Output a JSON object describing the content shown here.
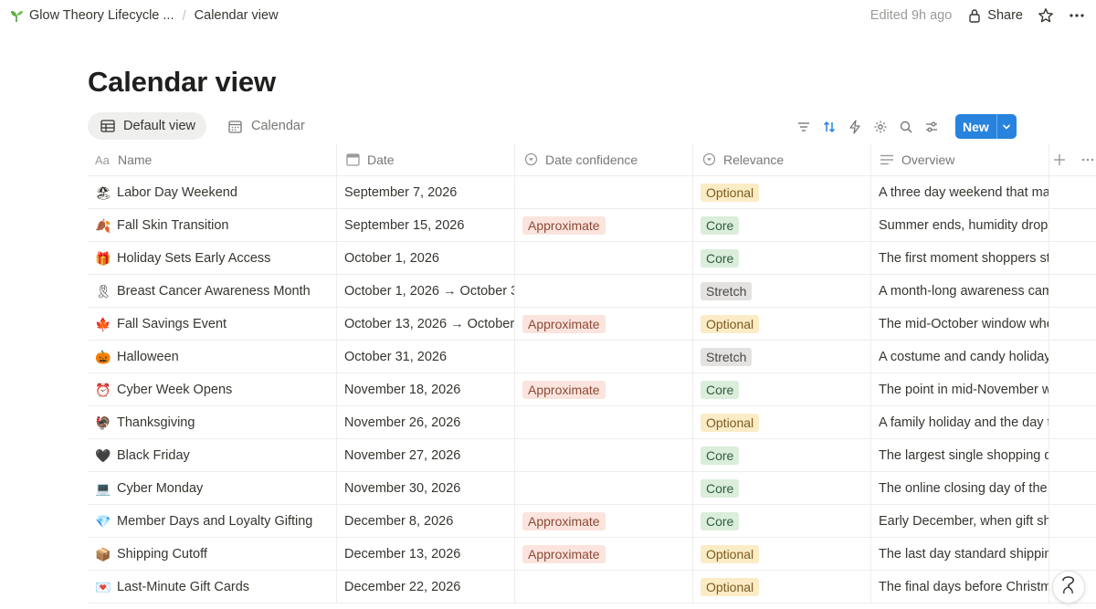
{
  "breadcrumb": {
    "parent": "Glow Theory Lifecycle ...",
    "current": "Calendar view",
    "parent_icon": "sprout-icon"
  },
  "topbar": {
    "edited": "Edited 9h ago",
    "share_label": "Share"
  },
  "page": {
    "title": "Calendar view"
  },
  "views": [
    {
      "label": "Default view",
      "icon": "table-icon",
      "active": true
    },
    {
      "label": "Calendar",
      "icon": "calendar-icon",
      "active": false
    }
  ],
  "toolbar": {
    "new_label": "New"
  },
  "columns": [
    {
      "label": "Name",
      "icon": "text-icon"
    },
    {
      "label": "Date",
      "icon": "calendar-icon"
    },
    {
      "label": "Date confidence",
      "icon": "select-icon"
    },
    {
      "label": "Relevance",
      "icon": "select-icon"
    },
    {
      "label": "Overview",
      "icon": "lines-icon"
    }
  ],
  "rows": [
    {
      "emoji": "🏖",
      "name": "Labor Day Weekend",
      "date": "September 7, 2026",
      "confidence": "",
      "relevance": "Optional",
      "overview": "A three day weekend that mar"
    },
    {
      "emoji": "🍂",
      "name": "Fall Skin Transition",
      "date": "September 15, 2026",
      "confidence": "Approximate",
      "relevance": "Core",
      "overview": "Summer ends, humidity drops"
    },
    {
      "emoji": "🎁",
      "name": "Holiday Sets Early Access",
      "date": "October 1, 2026",
      "confidence": "",
      "relevance": "Core",
      "overview": "The first moment shoppers sta"
    },
    {
      "emoji": "🎗",
      "name": "Breast Cancer Awareness Month",
      "date": "October 1, 2026 → October 3",
      "confidence": "",
      "relevance": "Stretch",
      "overview": "A month-long awareness cam"
    },
    {
      "emoji": "🍁",
      "name": "Fall Savings Event",
      "date": "October 13, 2026 → October",
      "confidence": "Approximate",
      "relevance": "Optional",
      "overview": "The mid-October window whe"
    },
    {
      "emoji": "🎃",
      "name": "Halloween",
      "date": "October 31, 2026",
      "confidence": "",
      "relevance": "Stretch",
      "overview": "A costume and candy holiday"
    },
    {
      "emoji": "⏰",
      "name": "Cyber Week Opens",
      "date": "November 18, 2026",
      "confidence": "Approximate",
      "relevance": "Core",
      "overview": "The point in mid-November w"
    },
    {
      "emoji": "🦃",
      "name": "Thanksgiving",
      "date": "November 26, 2026",
      "confidence": "",
      "relevance": "Optional",
      "overview": "A family holiday and the day t"
    },
    {
      "emoji": "🖤",
      "name": "Black Friday",
      "date": "November 27, 2026",
      "confidence": "",
      "relevance": "Core",
      "overview": "The largest single shopping d"
    },
    {
      "emoji": "💻",
      "name": "Cyber Monday",
      "date": "November 30, 2026",
      "confidence": "",
      "relevance": "Core",
      "overview": "The online closing day of the"
    },
    {
      "emoji": "💎",
      "name": "Member Days and Loyalty Gifting",
      "date": "December 8, 2026",
      "confidence": "Approximate",
      "relevance": "Core",
      "overview": "Early December, when gift sho"
    },
    {
      "emoji": "📦",
      "name": "Shipping Cutoff",
      "date": "December 13, 2026",
      "confidence": "Approximate",
      "relevance": "Optional",
      "overview": "The last day standard shippin"
    },
    {
      "emoji": "💌",
      "name": "Last-Minute Gift Cards",
      "date": "December 22, 2026",
      "confidence": "",
      "relevance": "Optional",
      "overview": "The final days before Christm"
    }
  ],
  "colors": {
    "accent": "#2783de",
    "tag_approximate": "#fbe4dd",
    "tag_optional": "#fbecc6",
    "tag_core": "#dbeddb",
    "tag_stretch": "#e3e2e0"
  }
}
